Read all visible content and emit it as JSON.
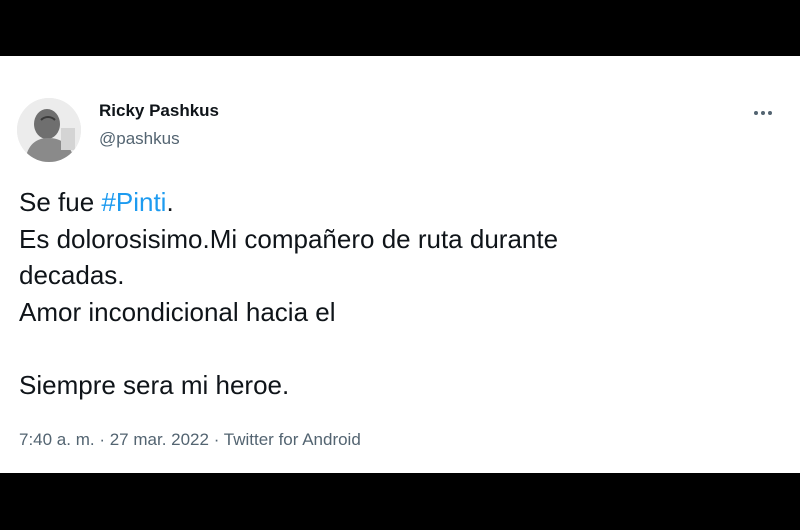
{
  "tweet": {
    "author": {
      "display_name": "Ricky Pashkus",
      "handle": "@pashkus"
    },
    "text": {
      "line1_prefix": "Se fue ",
      "hashtag": "#Pinti",
      "line1_suffix": ".",
      "line2": "Es dolorosisimo.Mi compañero de ruta durante",
      "line3": "decadas.",
      "line4": "Amor incondicional hacia el",
      "line6": "Siempre sera mi heroe."
    },
    "meta": {
      "time": "7:40 a. m.",
      "separator1": " · ",
      "date": "27 mar. 2022",
      "separator2": " · ",
      "source": "Twitter for Android"
    }
  },
  "icons": {
    "more": "more-options-icon",
    "avatar": "profile-photo"
  },
  "colors": {
    "text": "#0f1419",
    "secondary": "#536471",
    "hashtag": "#1d9bf0",
    "background": "#ffffff",
    "letterbox": "#000000"
  }
}
